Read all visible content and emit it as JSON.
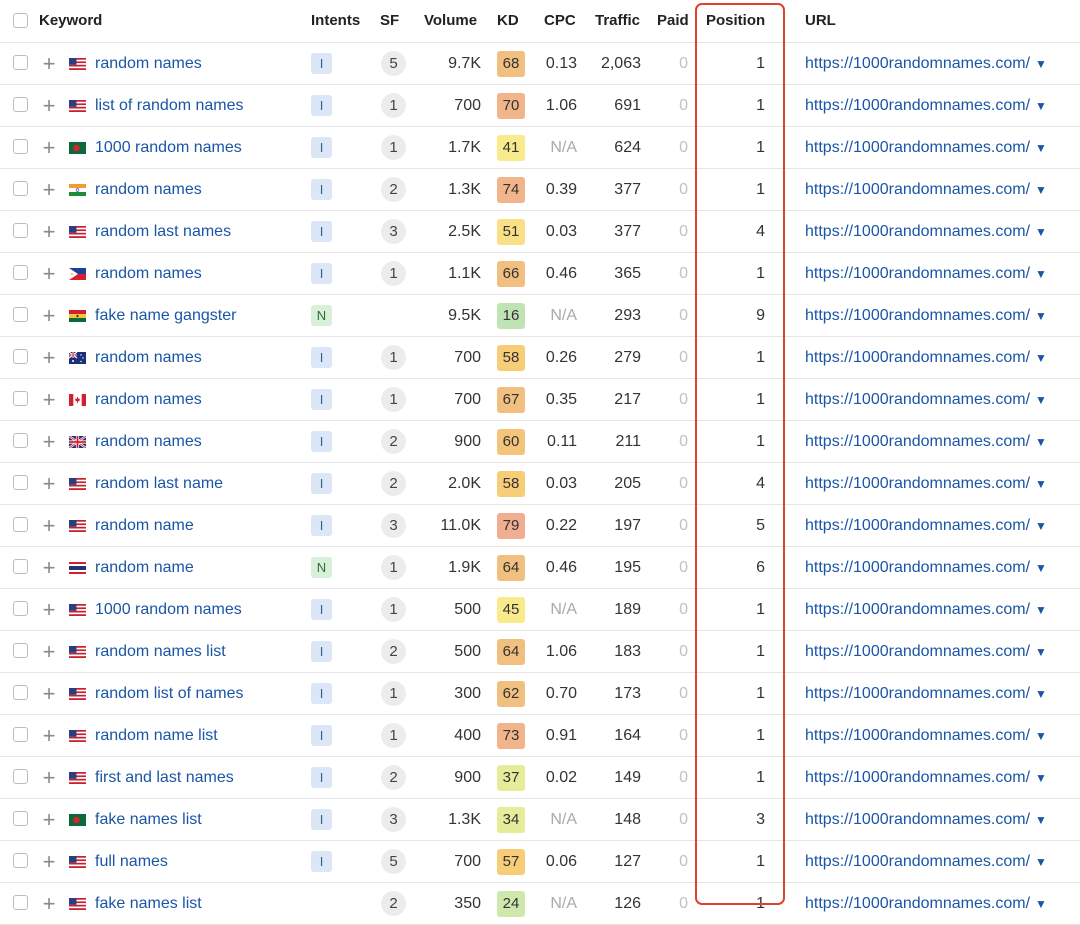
{
  "colors": {
    "highlight": "#e0412b",
    "link": "#1a55a6",
    "intent_informational": "#dbe7f7",
    "intent_navigational": "#d8efd9"
  },
  "columns": {
    "keyword": "Keyword",
    "intents": "Intents",
    "sf": "SF",
    "volume": "Volume",
    "kd": "KD",
    "cpc": "CPC",
    "traffic": "Traffic",
    "paid": "Paid",
    "position": "Position",
    "url": "URL"
  },
  "rows": [
    {
      "flag": "us",
      "keyword": "random names",
      "intent": "I",
      "sf": "5",
      "volume": "9.7K",
      "kd": "68",
      "kd_color": "#f1bf7f",
      "cpc": "0.13",
      "traffic": "2,063",
      "paid": "0",
      "position": "1",
      "url": "https://1000randomnames.com/"
    },
    {
      "flag": "us",
      "keyword": "list of random names",
      "intent": "I",
      "sf": "1",
      "volume": "700",
      "kd": "70",
      "kd_color": "#f2b48a",
      "cpc": "1.06",
      "traffic": "691",
      "paid": "0",
      "position": "1",
      "url": "https://1000randomnames.com/"
    },
    {
      "flag": "bd",
      "keyword": "1000 random names",
      "intent": "I",
      "sf": "1",
      "volume": "1.7K",
      "kd": "41",
      "kd_color": "#f9eb8c",
      "cpc": "N/A",
      "traffic": "624",
      "paid": "0",
      "position": "1",
      "url": "https://1000randomnames.com/"
    },
    {
      "flag": "in",
      "keyword": "random names",
      "intent": "I",
      "sf": "2",
      "volume": "1.3K",
      "kd": "74",
      "kd_color": "#f2b48a",
      "cpc": "0.39",
      "traffic": "377",
      "paid": "0",
      "position": "1",
      "url": "https://1000randomnames.com/"
    },
    {
      "flag": "us",
      "keyword": "random last names",
      "intent": "I",
      "sf": "3",
      "volume": "2.5K",
      "kd": "51",
      "kd_color": "#f9df86",
      "cpc": "0.03",
      "traffic": "377",
      "paid": "0",
      "position": "4",
      "url": "https://1000randomnames.com/"
    },
    {
      "flag": "ph",
      "keyword": "random names",
      "intent": "I",
      "sf": "1",
      "volume": "1.1K",
      "kd": "66",
      "kd_color": "#f1bf7f",
      "cpc": "0.46",
      "traffic": "365",
      "paid": "0",
      "position": "1",
      "url": "https://1000randomnames.com/"
    },
    {
      "flag": "gh",
      "keyword": "fake name gangster",
      "intent": "N",
      "sf": "",
      "volume": "9.5K",
      "kd": "16",
      "kd_color": "#bfe3b4",
      "cpc": "N/A",
      "traffic": "293",
      "paid": "0",
      "position": "9",
      "url": "https://1000randomnames.com/"
    },
    {
      "flag": "au",
      "keyword": "random names",
      "intent": "I",
      "sf": "1",
      "volume": "700",
      "kd": "58",
      "kd_color": "#f7cd78",
      "cpc": "0.26",
      "traffic": "279",
      "paid": "0",
      "position": "1",
      "url": "https://1000randomnames.com/"
    },
    {
      "flag": "ca",
      "keyword": "random names",
      "intent": "I",
      "sf": "1",
      "volume": "700",
      "kd": "67",
      "kd_color": "#f1bf7f",
      "cpc": "0.35",
      "traffic": "217",
      "paid": "0",
      "position": "1",
      "url": "https://1000randomnames.com/"
    },
    {
      "flag": "gb",
      "keyword": "random names",
      "intent": "I",
      "sf": "2",
      "volume": "900",
      "kd": "60",
      "kd_color": "#f5c47c",
      "cpc": "0.11",
      "traffic": "211",
      "paid": "0",
      "position": "1",
      "url": "https://1000randomnames.com/"
    },
    {
      "flag": "us",
      "keyword": "random last name",
      "intent": "I",
      "sf": "2",
      "volume": "2.0K",
      "kd": "58",
      "kd_color": "#f7cd78",
      "cpc": "0.03",
      "traffic": "205",
      "paid": "0",
      "position": "4",
      "url": "https://1000randomnames.com/"
    },
    {
      "flag": "us",
      "keyword": "random name",
      "intent": "I",
      "sf": "3",
      "volume": "11.0K",
      "kd": "79",
      "kd_color": "#f0ad8f",
      "cpc": "0.22",
      "traffic": "197",
      "paid": "0",
      "position": "5",
      "url": "https://1000randomnames.com/"
    },
    {
      "flag": "th",
      "keyword": "random name",
      "intent": "N",
      "sf": "1",
      "volume": "1.9K",
      "kd": "64",
      "kd_color": "#f1bf7f",
      "cpc": "0.46",
      "traffic": "195",
      "paid": "0",
      "position": "6",
      "url": "https://1000randomnames.com/"
    },
    {
      "flag": "us",
      "keyword": "1000 random names",
      "intent": "I",
      "sf": "1",
      "volume": "500",
      "kd": "45",
      "kd_color": "#f9eb8c",
      "cpc": "N/A",
      "traffic": "189",
      "paid": "0",
      "position": "1",
      "url": "https://1000randomnames.com/"
    },
    {
      "flag": "us",
      "keyword": "random names list",
      "intent": "I",
      "sf": "2",
      "volume": "500",
      "kd": "64",
      "kd_color": "#f1bf7f",
      "cpc": "1.06",
      "traffic": "183",
      "paid": "0",
      "position": "1",
      "url": "https://1000randomnames.com/"
    },
    {
      "flag": "us",
      "keyword": "random list of names",
      "intent": "I",
      "sf": "1",
      "volume": "300",
      "kd": "62",
      "kd_color": "#f1bf7f",
      "cpc": "0.70",
      "traffic": "173",
      "paid": "0",
      "position": "1",
      "url": "https://1000randomnames.com/"
    },
    {
      "flag": "us",
      "keyword": "random name list",
      "intent": "I",
      "sf": "1",
      "volume": "400",
      "kd": "73",
      "kd_color": "#f2b48a",
      "cpc": "0.91",
      "traffic": "164",
      "paid": "0",
      "position": "1",
      "url": "https://1000randomnames.com/"
    },
    {
      "flag": "us",
      "keyword": "first and last names",
      "intent": "I",
      "sf": "2",
      "volume": "900",
      "kd": "37",
      "kd_color": "#e6ec99",
      "cpc": "0.02",
      "traffic": "149",
      "paid": "0",
      "position": "1",
      "url": "https://1000randomnames.com/"
    },
    {
      "flag": "bd",
      "keyword": "fake names list",
      "intent": "I",
      "sf": "3",
      "volume": "1.3K",
      "kd": "34",
      "kd_color": "#e6ec99",
      "cpc": "N/A",
      "traffic": "148",
      "paid": "0",
      "position": "3",
      "url": "https://1000randomnames.com/"
    },
    {
      "flag": "us",
      "keyword": "full names",
      "intent": "I",
      "sf": "5",
      "volume": "700",
      "kd": "57",
      "kd_color": "#f7cd78",
      "cpc": "0.06",
      "traffic": "127",
      "paid": "0",
      "position": "1",
      "url": "https://1000randomnames.com/"
    },
    {
      "flag": "us",
      "keyword": "fake names list",
      "intent": "",
      "sf": "2",
      "volume": "350",
      "kd": "24",
      "kd_color": "#cfe8ab",
      "cpc": "N/A",
      "traffic": "126",
      "paid": "0",
      "position": "1",
      "url": "https://1000randomnames.com/"
    }
  ]
}
